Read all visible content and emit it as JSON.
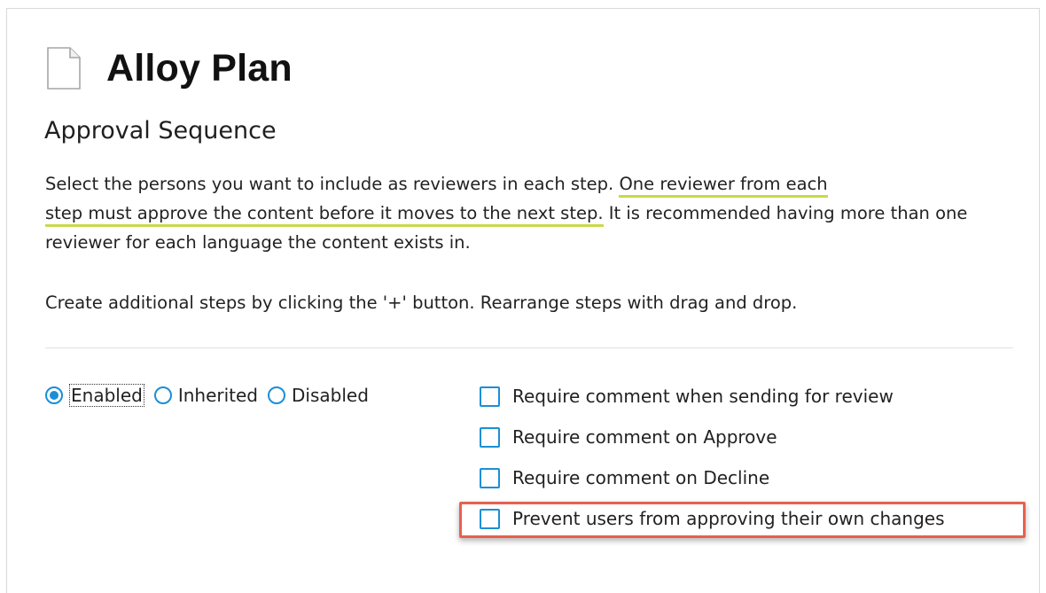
{
  "page": {
    "title": "Alloy Plan",
    "subtitle": "Approval Sequence",
    "description": {
      "part1": "Select the persons you want to include as reviewers in each step. ",
      "highlight_line1": "One reviewer from each",
      "highlight_line2": "step must approve the content before it moves to the next step.",
      "part2": " It is recommended having more than one reviewer for each language the content exists in."
    },
    "instructions": "Create additional steps by clicking the '+' button. Rearrange steps with drag and drop."
  },
  "status_options": {
    "selected": "Enabled",
    "items": [
      {
        "label": "Enabled",
        "checked": true
      },
      {
        "label": "Inherited",
        "checked": false
      },
      {
        "label": "Disabled",
        "checked": false
      }
    ]
  },
  "settings": [
    {
      "label": "Require comment when sending for review",
      "checked": false
    },
    {
      "label": "Require comment on Approve",
      "checked": false
    },
    {
      "label": "Require comment on Decline",
      "checked": false
    },
    {
      "label": "Prevent users from approving their own changes",
      "checked": false
    }
  ],
  "icons": {
    "document": "document-icon"
  },
  "colors": {
    "accent": "#1a8fd6",
    "text_underline": "#c8d94a",
    "highlight_border": "#e8604c"
  }
}
